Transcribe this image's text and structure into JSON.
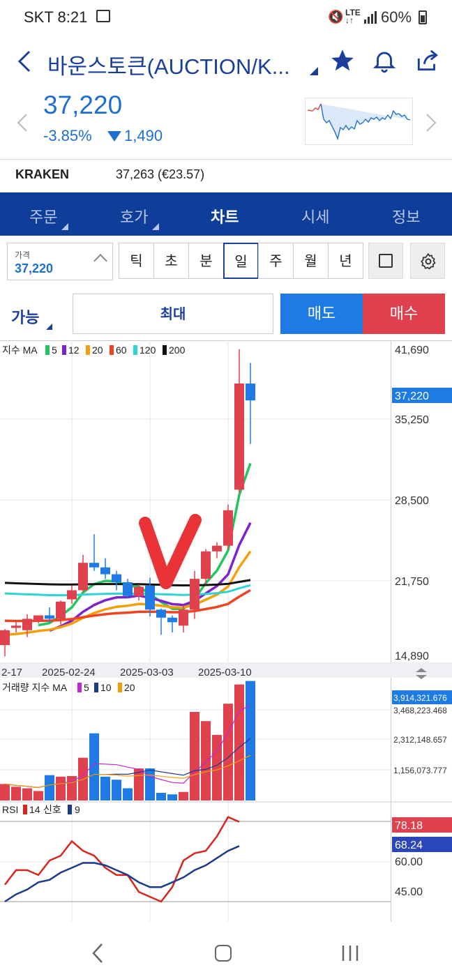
{
  "status_bar": {
    "carrier_time": "SKT 8:21",
    "battery": "60%"
  },
  "header": {
    "title": "바운스토큰(AUCTION/K...",
    "price": "37,220",
    "change_pct": "-3.85%",
    "change_abs": "1,490"
  },
  "exchange": {
    "name": "KRAKEN",
    "value": "37,263 (€23.57)"
  },
  "nav_tabs": [
    {
      "label": "주문"
    },
    {
      "label": "호가"
    },
    {
      "label": "차트"
    },
    {
      "label": "시세"
    },
    {
      "label": "정보"
    }
  ],
  "controls": {
    "price_label": "가격",
    "price_value": "37,220",
    "periods": [
      "틱",
      "초",
      "분",
      "일",
      "주",
      "월",
      "년"
    ],
    "selected_period": "일"
  },
  "order": {
    "available": "가능",
    "max": "최대",
    "sell": "매도",
    "buy": "매수"
  },
  "colors": {
    "nav_bg": "#0e3d9a",
    "up": "#e0414f",
    "down": "#1e7be3"
  },
  "chart_data": [
    {
      "type": "candlestick",
      "legend": "지수 MA",
      "ma_periods": [
        "5",
        "12",
        "20",
        "60",
        "120",
        "200"
      ],
      "ma_colors": [
        "#22c55e",
        "#7e22ce",
        "#f59e0b",
        "#f0431f",
        "#2dd4d4",
        "#111111"
      ],
      "y_ticks": [
        "41,690",
        "35,250",
        "28,500",
        "21,750",
        "14,890"
      ],
      "current_price": "37,220",
      "x_labels": [
        "2-17",
        "2025-02-24",
        "2025-03-03",
        "2025-03-10"
      ],
      "candles": [
        {
          "o": 17100,
          "h": 17200,
          "l": 14800,
          "c": 15800,
          "dir": "up"
        },
        {
          "o": 17500,
          "h": 17800,
          "l": 16900,
          "c": 17300,
          "dir": "up"
        },
        {
          "o": 17100,
          "h": 18500,
          "l": 16500,
          "c": 18100,
          "dir": "up"
        },
        {
          "o": 17900,
          "h": 18400,
          "l": 17700,
          "c": 18400,
          "dir": "up"
        },
        {
          "o": 18400,
          "h": 19100,
          "l": 17800,
          "c": 18100,
          "dir": "down"
        },
        {
          "o": 18100,
          "h": 19700,
          "l": 17600,
          "c": 19600,
          "dir": "up"
        },
        {
          "o": 19800,
          "h": 21000,
          "l": 19400,
          "c": 20600,
          "dir": "up"
        },
        {
          "o": 20600,
          "h": 23700,
          "l": 20400,
          "c": 23000,
          "dir": "up"
        },
        {
          "o": 23000,
          "h": 25500,
          "l": 22300,
          "c": 22600,
          "dir": "down"
        },
        {
          "o": 22600,
          "h": 23400,
          "l": 21600,
          "c": 22000,
          "dir": "down"
        },
        {
          "o": 22000,
          "h": 22300,
          "l": 20600,
          "c": 21300,
          "dir": "down"
        },
        {
          "o": 21300,
          "h": 21600,
          "l": 19900,
          "c": 20100,
          "dir": "down"
        },
        {
          "o": 20100,
          "h": 21100,
          "l": 19700,
          "c": 20900,
          "dir": "up"
        },
        {
          "o": 21000,
          "h": 21700,
          "l": 18300,
          "c": 18900,
          "dir": "down"
        },
        {
          "o": 18900,
          "h": 19000,
          "l": 16700,
          "c": 18200,
          "dir": "down"
        },
        {
          "o": 18200,
          "h": 18400,
          "l": 16900,
          "c": 17800,
          "dir": "down"
        },
        {
          "o": 17500,
          "h": 19300,
          "l": 16900,
          "c": 18900,
          "dir": "up"
        },
        {
          "o": 18900,
          "h": 22300,
          "l": 18100,
          "c": 21600,
          "dir": "up"
        },
        {
          "o": 21600,
          "h": 24200,
          "l": 21100,
          "c": 24000,
          "dir": "up"
        },
        {
          "o": 24000,
          "h": 24800,
          "l": 23400,
          "c": 24500,
          "dir": "up"
        },
        {
          "o": 24500,
          "h": 28100,
          "l": 24200,
          "c": 27600,
          "dir": "up"
        },
        {
          "o": 29400,
          "h": 41700,
          "l": 29100,
          "c": 38700,
          "dir": "up"
        },
        {
          "o": 38700,
          "h": 40500,
          "l": 33400,
          "c": 37220,
          "dir": "down"
        }
      ]
    },
    {
      "type": "bar",
      "legend": "거래량 지수 MA",
      "ma_periods": [
        "5",
        "10",
        "20"
      ],
      "ma_colors": [
        "#c026d3",
        "#1e3a8a",
        "#f59e0b"
      ],
      "y_ticks": [
        "3,914,321.676",
        "3,468,223.468",
        "2,312,148.657",
        "1,156,073.777"
      ],
      "values": [
        540000,
        450000,
        400000,
        310000,
        830000,
        780000,
        800000,
        1400000,
        2200000,
        780000,
        680000,
        400000,
        1050000,
        1050000,
        250000,
        200000,
        280000,
        2900000,
        2600000,
        2150000,
        3170000,
        3800000,
        3914321
      ]
    },
    {
      "type": "line",
      "legend": "RSI",
      "series": [
        {
          "name": "14",
          "color": "#d7261b"
        },
        {
          "name": "신호",
          "color": "#1e3a8a"
        }
      ],
      "signal_period": "9",
      "y_ticks": [
        "78.18",
        "68.24",
        "60.00",
        "45.00"
      ],
      "rsi": [
        52,
        58,
        58,
        56,
        62,
        64,
        70,
        66,
        64,
        59,
        56,
        56,
        49,
        47,
        45,
        51,
        62,
        65,
        66,
        72,
        80,
        78
      ],
      "signal": [
        45,
        48,
        50,
        53,
        54,
        57,
        59,
        61,
        61,
        60,
        58,
        56,
        53,
        51,
        51,
        53,
        55,
        58,
        60,
        63,
        66,
        68
      ]
    }
  ]
}
